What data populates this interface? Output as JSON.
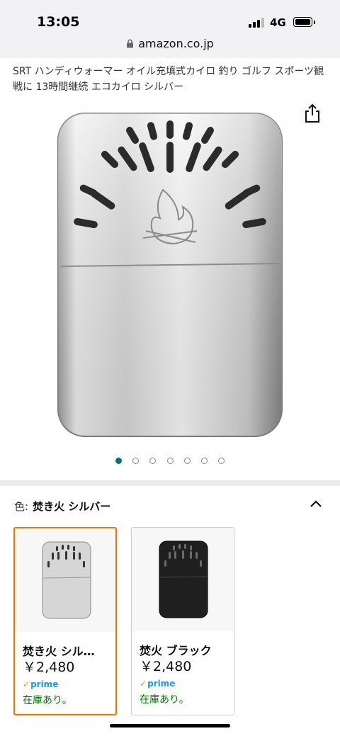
{
  "status_bar": {
    "time": "13:05",
    "network": "4G"
  },
  "browser": {
    "url": "amazon.co.jp"
  },
  "product": {
    "title": "SRT ハンディウォーマー オイル充填式カイロ 釣り ゴルフ スポーツ観戦に 13時間継続 エコカイロ シルバー",
    "image_icon": "hand-warmer-silver-image",
    "carousel": {
      "total": 7,
      "active_index": 0
    }
  },
  "variation": {
    "label": "色:",
    "selected_value": "焚き火 シルバー",
    "options": [
      {
        "name": "焚き火 シル…",
        "price": "￥2,480",
        "prime": "prime",
        "stock": "在庫あり。",
        "selected": true,
        "color": "silver"
      },
      {
        "name": "焚火 ブラック",
        "price": "￥2,480",
        "prime": "prime",
        "stock": "在庫あり。",
        "selected": false,
        "color": "black"
      }
    ]
  },
  "colors": {
    "accent_selected": "#e77600",
    "prime_blue": "#1a98ff",
    "in_stock_green": "#007600",
    "dot_active": "#007185"
  }
}
